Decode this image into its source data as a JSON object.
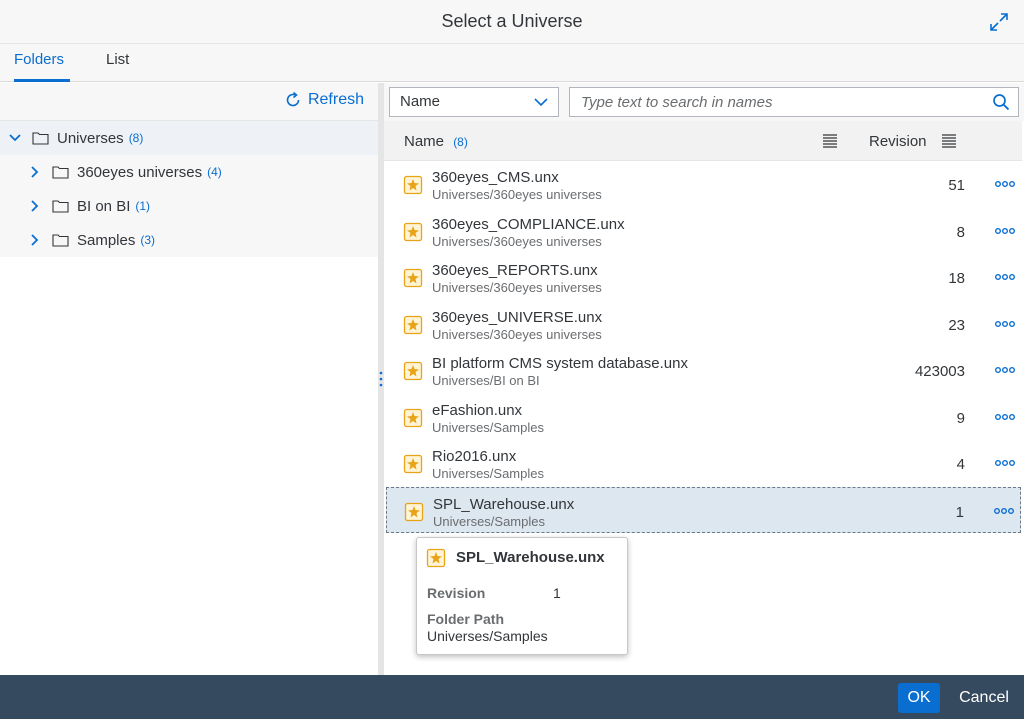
{
  "dialog": {
    "title": "Select a Universe"
  },
  "tabs": [
    {
      "label": "Folders",
      "active": true
    },
    {
      "label": "List",
      "active": false
    }
  ],
  "left": {
    "refresh_label": "Refresh",
    "tree": [
      {
        "label": "Universes",
        "count": "(8)",
        "expanded": true
      },
      {
        "label": "360eyes universes",
        "count": "(4)"
      },
      {
        "label": "BI on BI",
        "count": "(1)"
      },
      {
        "label": "Samples",
        "count": "(3)"
      }
    ]
  },
  "right": {
    "sort_select": {
      "value": "Name"
    },
    "search": {
      "placeholder": "Type text to search in names",
      "value": ""
    },
    "columns": {
      "name": "Name",
      "name_count": "(8)",
      "revision": "Revision"
    },
    "rows": [
      {
        "name": "360eyes_CMS.unx",
        "path": "Universes/360eyes universes",
        "revision": "51"
      },
      {
        "name": "360eyes_COMPLIANCE.unx",
        "path": "Universes/360eyes universes",
        "revision": "8"
      },
      {
        "name": "360eyes_REPORTS.unx",
        "path": "Universes/360eyes universes",
        "revision": "18"
      },
      {
        "name": "360eyes_UNIVERSE.unx",
        "path": "Universes/360eyes universes",
        "revision": "23"
      },
      {
        "name": "BI platform CMS system database.unx",
        "path": "Universes/BI on BI",
        "revision": "423003"
      },
      {
        "name": "eFashion.unx",
        "path": "Universes/Samples",
        "revision": "9"
      },
      {
        "name": "Rio2016.unx",
        "path": "Universes/Samples",
        "revision": "4"
      },
      {
        "name": "SPL_Warehouse.unx",
        "path": "Universes/Samples",
        "revision": "1",
        "selected": true
      }
    ]
  },
  "tooltip": {
    "title": "SPL_Warehouse.unx",
    "revision_label": "Revision",
    "revision_value": "1",
    "folder_label": "Folder Path",
    "folder_value": "Universes/Samples"
  },
  "footer": {
    "ok_label": "OK",
    "cancel_label": "Cancel"
  },
  "colors": {
    "accent": "#0a6ed1",
    "footer_bg": "#354a5f",
    "icon_gold": "#e8a317",
    "selected_row": "#dde7f0"
  }
}
